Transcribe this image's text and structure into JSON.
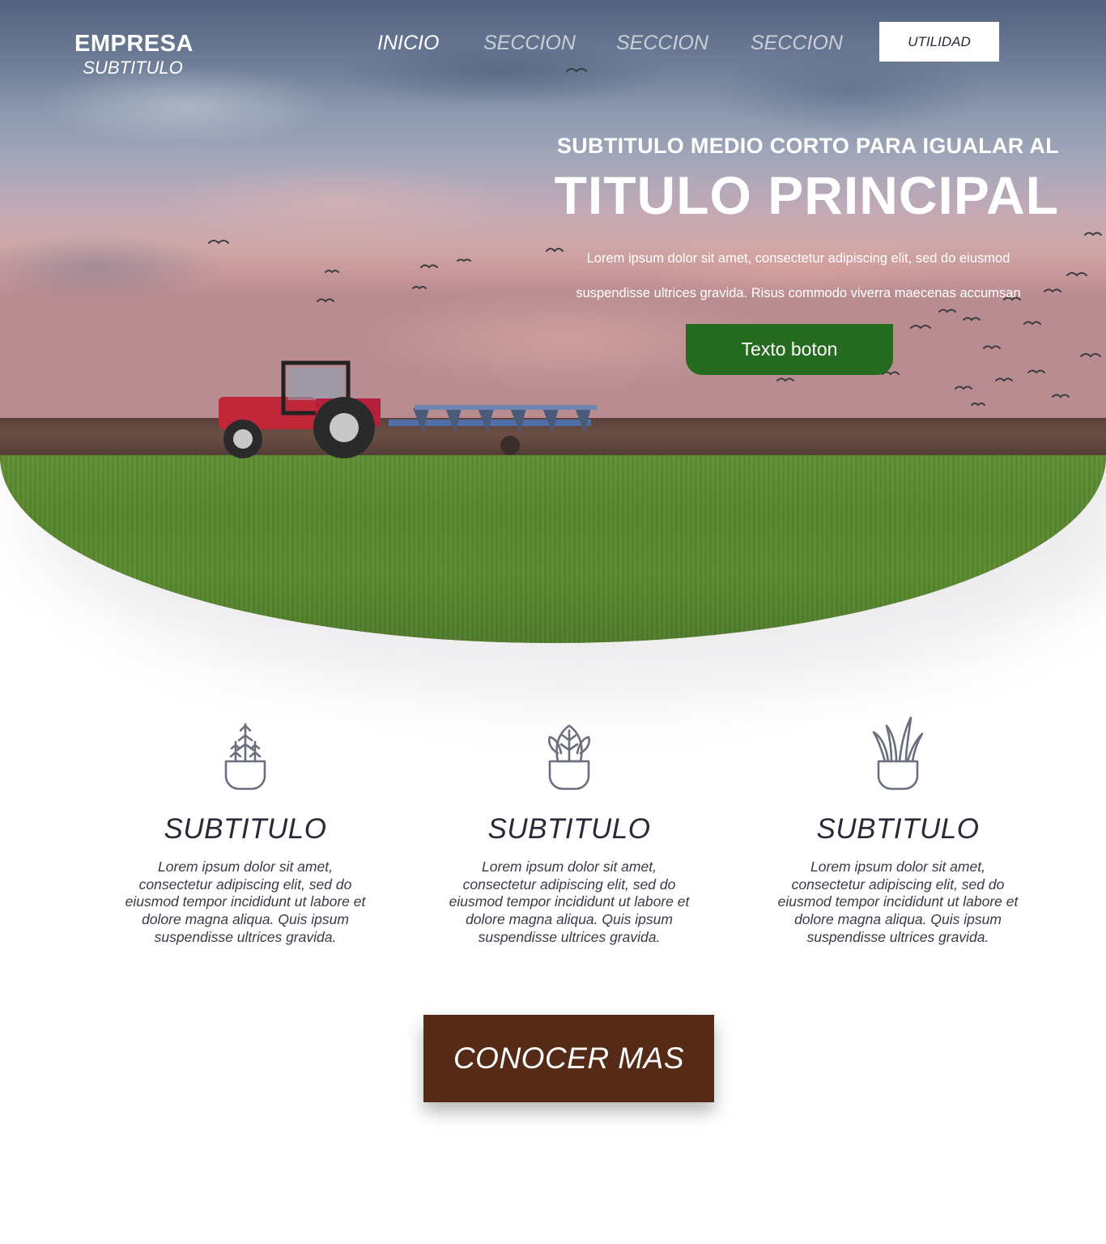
{
  "brand": {
    "name": "EMPRESA",
    "subtitle": "SUBTITULO"
  },
  "nav": {
    "items": [
      {
        "label": "INICIO",
        "active": true
      },
      {
        "label": "SECCION",
        "active": false
      },
      {
        "label": "SECCION",
        "active": false
      },
      {
        "label": "SECCION",
        "active": false
      }
    ],
    "utility_label": "UTILIDAD"
  },
  "hero": {
    "eyebrow": "SUBTITULO MEDIO CORTO PARA IGUALAR AL",
    "title": "TITULO PRINCIPAL",
    "text_line1": "Lorem ipsum dolor sit amet, consectetur adipiscing elit, sed do eiusmod",
    "text_line2": "suspendisse ultrices gravida. Risus commodo viverra maecenas accumsan",
    "button_label": "Texto boton"
  },
  "features": [
    {
      "icon": "potted-sprout-icon",
      "title": "SUBTITULO",
      "text": "Lorem ipsum dolor sit amet, consectetur adipiscing elit, sed do eiusmod tempor incididunt ut labore et dolore magna aliqua. Quis ipsum suspendisse ultrices gravida."
    },
    {
      "icon": "potted-leaf-icon",
      "title": "SUBTITULO",
      "text": "Lorem ipsum dolor sit amet, consectetur adipiscing elit, sed do eiusmod tempor incididunt ut labore et dolore magna aliqua. Quis ipsum suspendisse ultrices gravida."
    },
    {
      "icon": "potted-grass-icon",
      "title": "SUBTITULO",
      "text": "Lorem ipsum dolor sit amet, consectetur adipiscing elit, sed do eiusmod tempor incididunt ut labore et dolore magna aliqua. Quis ipsum suspendisse ultrices gravida."
    }
  ],
  "cta": {
    "label": "CONOCER MAS"
  },
  "colors": {
    "hero_button": "#256b1f",
    "cta_button": "#552a16",
    "icon_stroke": "#6b6f7d",
    "text_dark": "#2a2a36"
  }
}
